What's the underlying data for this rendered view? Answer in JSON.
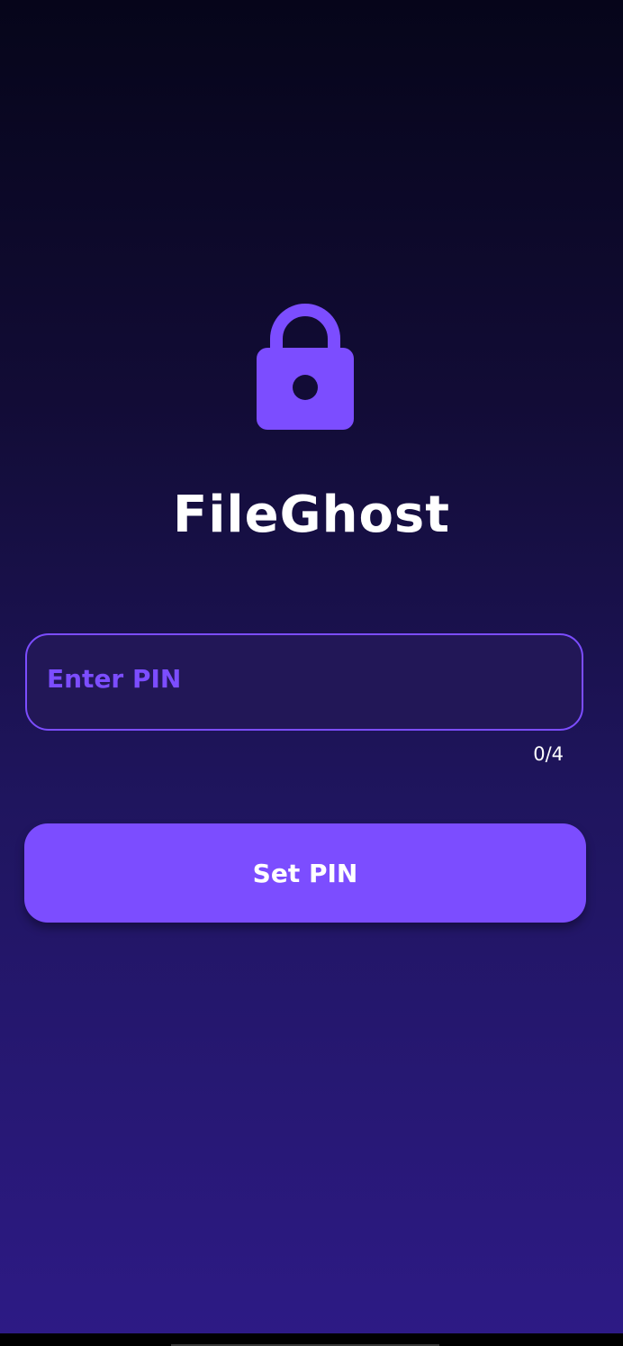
{
  "app": {
    "title": "FileGhost",
    "icon": "lock-icon"
  },
  "pin_field": {
    "value": "",
    "placeholder": "Enter PIN",
    "counter": "0/4"
  },
  "actions": {
    "set_pin_label": "Set PIN"
  },
  "colors": {
    "accent": "#7c4dff",
    "background_top": "#06051a",
    "background_bottom": "#2d1a85",
    "field_fill": "#221757",
    "text": "#ffffff"
  }
}
